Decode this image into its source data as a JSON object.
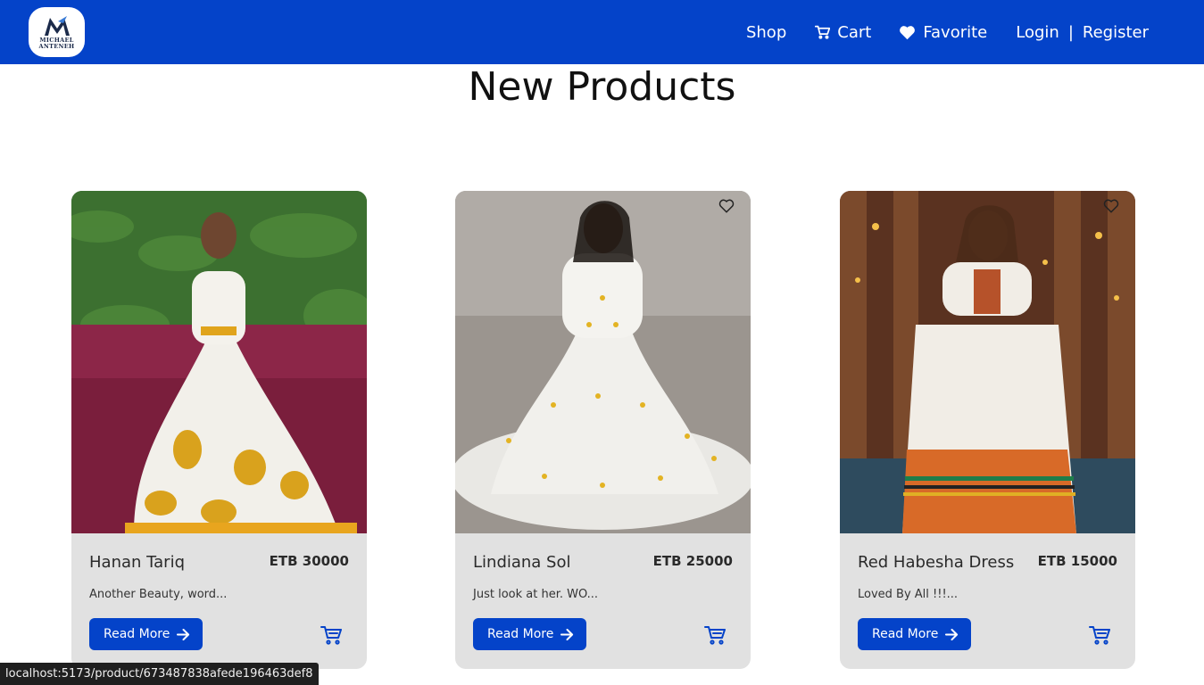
{
  "brand": {
    "logo_line1": "MICHAEL",
    "logo_line2": "ANTENEH",
    "accent": "#0443c9"
  },
  "nav": {
    "shop": "Shop",
    "cart": "Cart",
    "favorite": "Favorite",
    "login": "Login",
    "separator": "|",
    "register": "Register"
  },
  "page": {
    "title": "New Products"
  },
  "products": [
    {
      "name": "Hanan Tariq",
      "price": "ETB 30000",
      "description": "Another Beauty, word...",
      "read_more": "Read More",
      "icons": [
        "cart-icon"
      ]
    },
    {
      "name": "Lindiana Sol",
      "price": "ETB 25000",
      "description": "Just look at her. WO...",
      "read_more": "Read More",
      "icons": [
        "heart-outline-icon",
        "cart-icon"
      ]
    },
    {
      "name": "Red Habesha Dress",
      "price": "ETB 15000",
      "description": "Loved By All !!!...",
      "read_more": "Read More",
      "icons": [
        "heart-outline-icon",
        "cart-icon"
      ]
    }
  ],
  "status_bar": {
    "url": "localhost:5173/product/673487838afede196463def8"
  }
}
